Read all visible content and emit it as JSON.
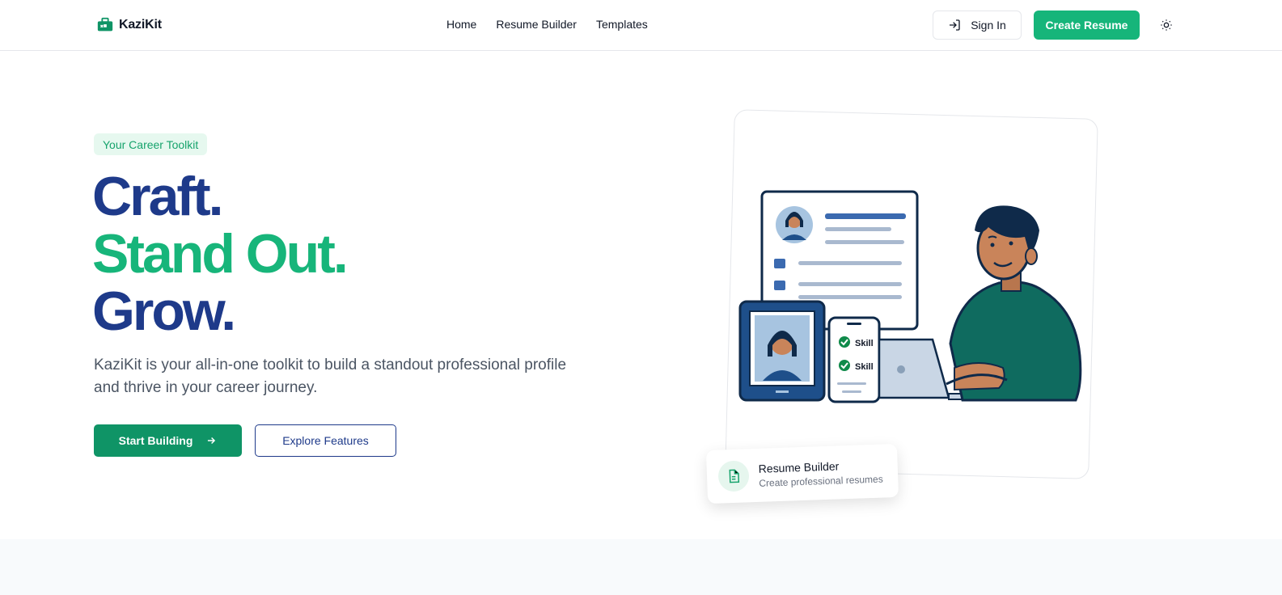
{
  "brand": {
    "name": "KaziKit"
  },
  "nav": {
    "items": [
      "Home",
      "Resume Builder",
      "Templates"
    ]
  },
  "header": {
    "sign_in": "Sign In",
    "create_resume": "Create Resume"
  },
  "hero": {
    "badge": "Your Career Toolkit",
    "line1": "Craft.",
    "line2": "Stand Out.",
    "line3": "Grow.",
    "description": "KaziKit is your all-in-one toolkit to build a standout professional profile and thrive in your career journey.",
    "primary_cta": "Start Building",
    "secondary_cta": "Explore Features"
  },
  "illustration": {
    "skill_labels": [
      "Skill",
      "Skill"
    ]
  },
  "floating_card": {
    "title": "Resume Builder",
    "subtitle": "Create professional resumes"
  },
  "colors": {
    "navy": "#1e3a8a",
    "green": "#17b57a",
    "dark_green": "#0f9466",
    "teal": "#0f6b5f"
  }
}
